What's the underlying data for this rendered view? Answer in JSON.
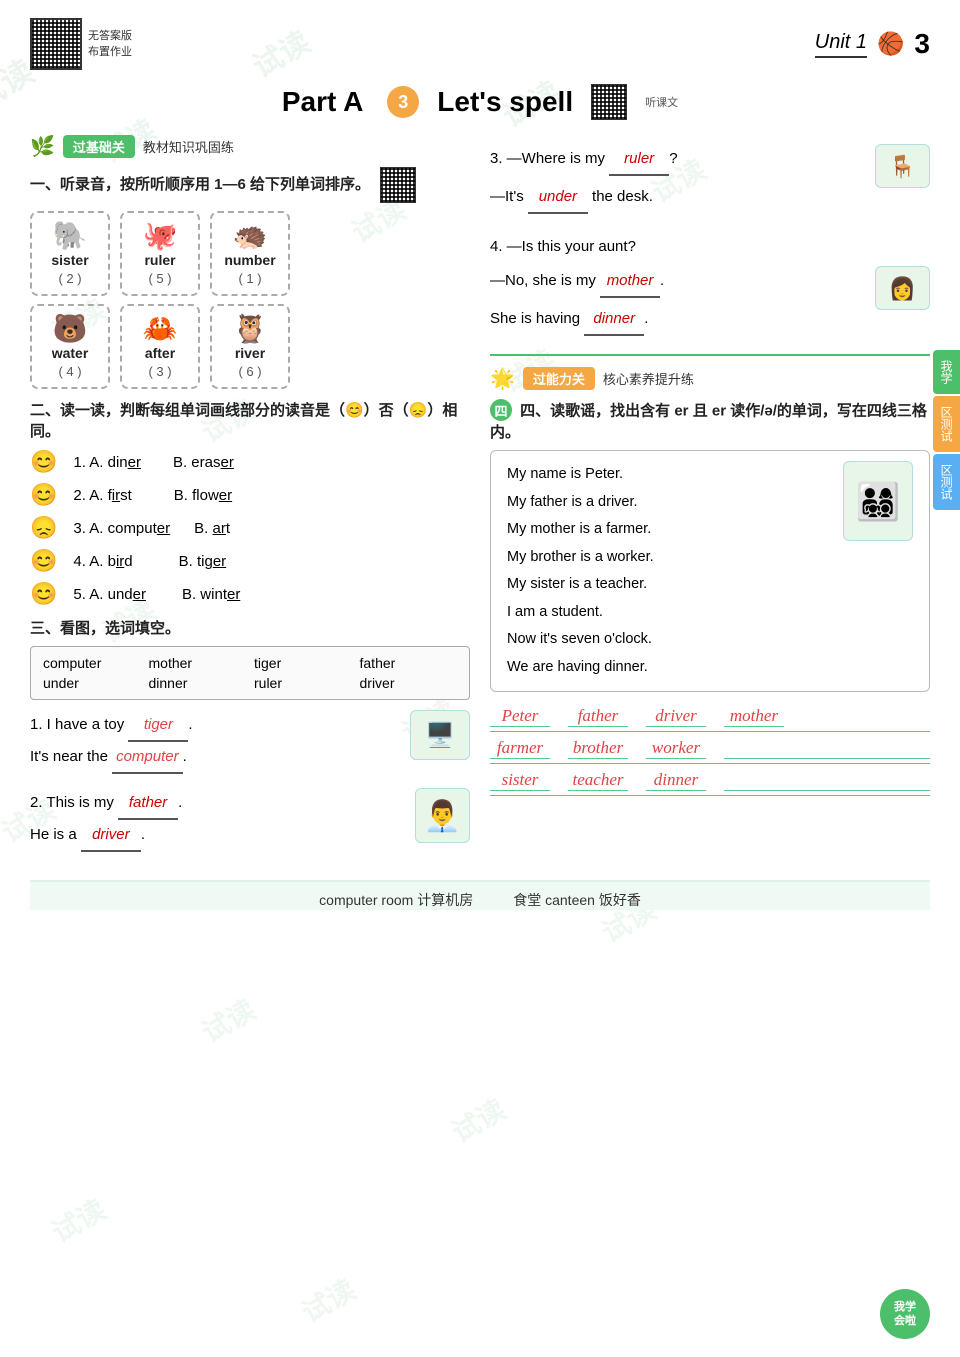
{
  "header": {
    "unit_label": "Unit 1",
    "page_number": "3",
    "qr_left_label1": "无答案版",
    "qr_left_label2": "布置作业"
  },
  "title": {
    "part": "Part A",
    "part_num": "3",
    "subtitle": "Let's spell"
  },
  "left": {
    "section1_badge": "过基础关",
    "section1_subtitle": "教材知识巩固练",
    "ex1_label": "一、听录音，按所听顺序用 1—6 给下列单词排序。",
    "words": [
      {
        "text": "sister",
        "num": "2",
        "emoji": "🐘"
      },
      {
        "text": "ruler",
        "num": "5",
        "emoji": "🐙"
      },
      {
        "text": "number",
        "num": "1",
        "emoji": "🦔"
      },
      {
        "text": "water",
        "num": "4",
        "emoji": "🐻"
      },
      {
        "text": "after",
        "num": "3",
        "emoji": "🦀"
      },
      {
        "text": "river",
        "num": "6",
        "emoji": "🦉"
      }
    ],
    "ex2_label": "二、读一读，判断每组单词画线部分的读音是（😊）否（😞）相同。",
    "pron_items": [
      {
        "num": "1",
        "a": "dinner",
        "a_ul": "er",
        "b": "eraser",
        "b_ul": "er",
        "same": true
      },
      {
        "num": "2",
        "a": "first",
        "a_ul": "ir",
        "b": "flower",
        "b_ul": "er",
        "same": true
      },
      {
        "num": "3",
        "a": "computer",
        "a_ul": "er",
        "b": "art",
        "b_ul": "ar",
        "same": false
      },
      {
        "num": "4",
        "a": "bird",
        "a_ul": "ir",
        "b": "tiger",
        "b_ul": "er",
        "same": true
      },
      {
        "num": "5",
        "a": "under",
        "a_ul": "er",
        "b": "winter",
        "b_ul": "er",
        "same": true
      }
    ],
    "ex3_label": "三、看图，选词填空。",
    "word_bank": [
      "computer",
      "mother",
      "tiger",
      "father",
      "under",
      "dinner",
      "ruler",
      "driver"
    ],
    "fill_items": [
      {
        "q1": "1. I have a toy ",
        "a1": "tiger",
        "q2": "It's near the ",
        "a2": "computer"
      },
      {
        "q1": "2. This is my ",
        "a1": "father",
        "q2": "He is a ",
        "a2": "driver"
      }
    ]
  },
  "right": {
    "q3": {
      "q1": "3. —Where is my ",
      "a1": "ruler",
      "q2": "—It's ",
      "a2": "under",
      "q2_end": " the desk."
    },
    "q4": {
      "q1": "4. —Is this your aunt?",
      "q2": "—No, she is my ",
      "a2": "mother",
      "q3": "She is having ",
      "a3": "dinner"
    },
    "section2_badge": "过能力关",
    "section2_subtitle": "核心素养提升练",
    "ex4_label": "四、读歌谣，找出含有 er 且 er 读作/ə/的单词，写在四线三格内。",
    "passage": [
      "My name is Peter.",
      "My father is a driver.",
      "My mother is a farmer.",
      "My brother is a worker.",
      "My sister is a teacher.",
      "I am a student.",
      "Now it's seven o'clock.",
      "We are having dinner."
    ],
    "hw_lines": [
      [
        "Peter",
        "father",
        "driver",
        "mother"
      ],
      [
        "farmer",
        "brother",
        "worker",
        ""
      ],
      [
        "sister",
        "teacher",
        "dinner",
        ""
      ]
    ]
  },
  "bottom_bar": {
    "item1": "computer room 计算机房",
    "item2": "食堂 canteen 饭好香"
  },
  "side_tabs": [
    "我学",
    "区测试",
    "区测试"
  ],
  "bottom_badge": "我学\n会啦"
}
